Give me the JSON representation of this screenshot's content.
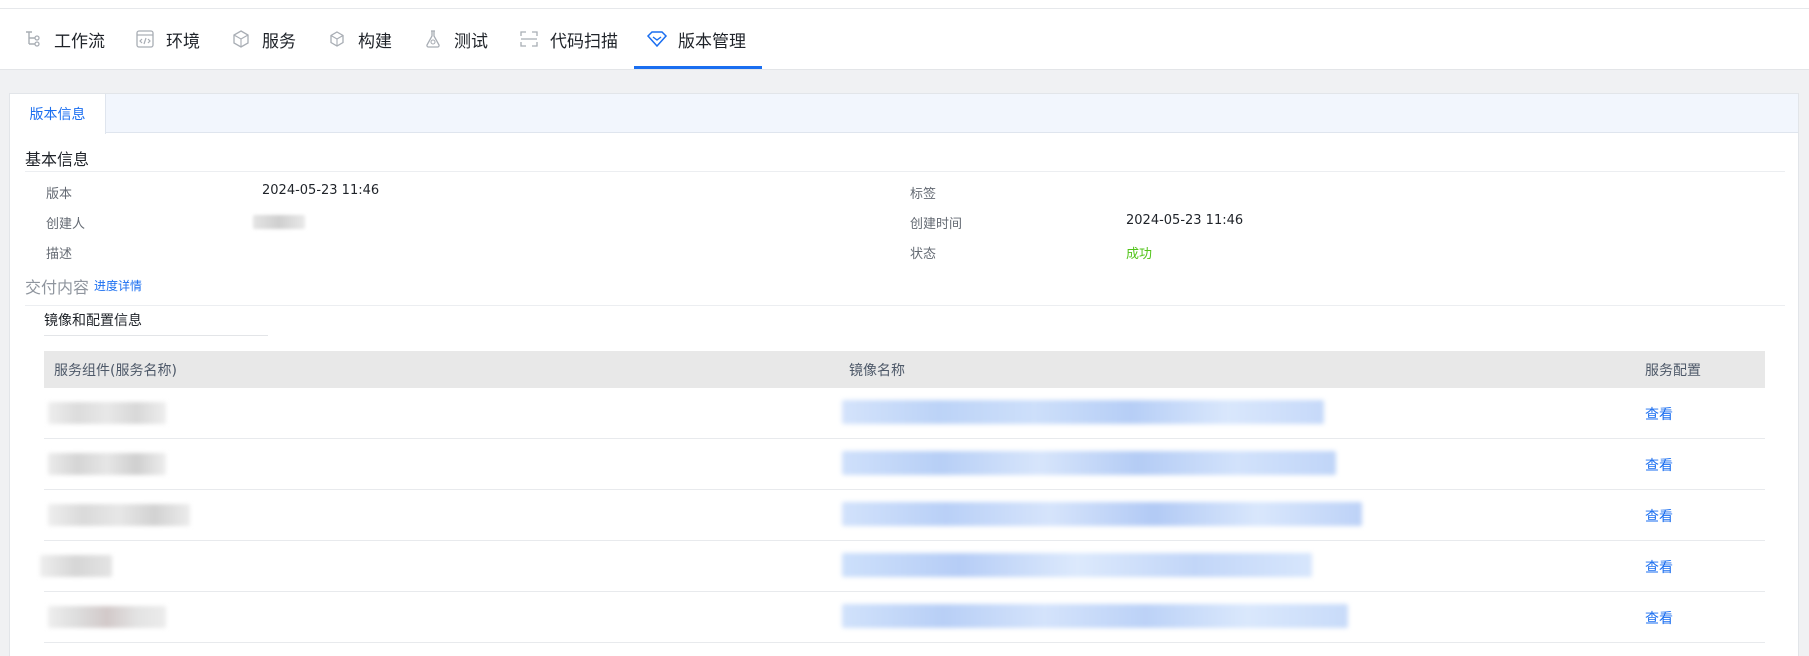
{
  "nav": {
    "tabs": [
      {
        "label": "工作流",
        "icon": "workflow-icon"
      },
      {
        "label": "环境",
        "icon": "code-window-icon"
      },
      {
        "label": "服务",
        "icon": "cube-cluster-icon"
      },
      {
        "label": "构建",
        "icon": "cube-icon"
      },
      {
        "label": "测试",
        "icon": "flask-icon"
      },
      {
        "label": "代码扫描",
        "icon": "scan-icon"
      },
      {
        "label": "版本管理",
        "icon": "diamond-icon"
      }
    ],
    "active_index": 6,
    "accent": "#1a6ef0"
  },
  "tab": {
    "label": "版本信息"
  },
  "basic": {
    "title": "基本信息",
    "version_label": "版本",
    "version_value": "2024-05-23 11:46",
    "tag_label": "标签",
    "tag_value": "",
    "creator_label": "创建人",
    "created_time_label": "创建时间",
    "created_time_value": "2024-05-23 11:46",
    "desc_label": "描述",
    "desc_value": "",
    "status_label": "状态",
    "status_value": "成功",
    "status_color": "#52c41a"
  },
  "delivery": {
    "title": "交付内容",
    "progress_link": "进度详情",
    "subtitle": "镜像和配置信息"
  },
  "table": {
    "headers": [
      "服务组件(服务名称)",
      "镜像名称",
      "服务配置"
    ],
    "rows": [
      {
        "action": "查看"
      },
      {
        "action": "查看"
      },
      {
        "action": "查看"
      },
      {
        "action": "查看"
      },
      {
        "action": "查看"
      }
    ]
  }
}
